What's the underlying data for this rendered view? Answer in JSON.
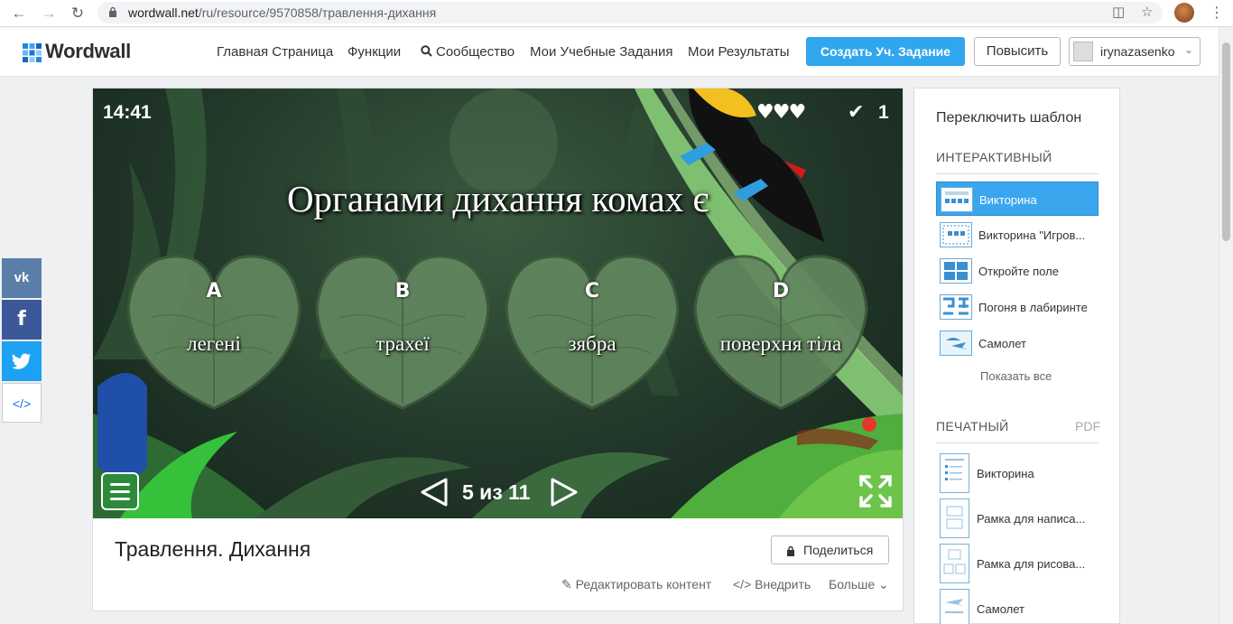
{
  "browser": {
    "url_host": "wordwall.net",
    "url_path": "/ru/resource/9570858/травлення-дихання"
  },
  "header": {
    "logo": "Wordwall",
    "nav": [
      "Главная Страница",
      "Функции",
      "Сообщество",
      "Мои Учебные Задания",
      "Мои Результаты"
    ],
    "create_label": "Создать Уч. Задание",
    "upgrade_label": "Повысить",
    "username": "irynazasenko"
  },
  "social": {
    "vk": "vk",
    "fb": "f",
    "embed": "</>"
  },
  "game": {
    "timer": "14:41",
    "hearts": "♥♥♥",
    "score": "1",
    "question": "Органами дихання комах є",
    "answers": [
      {
        "letter": "A",
        "text": "легені"
      },
      {
        "letter": "B",
        "text": "трахеї"
      },
      {
        "letter": "C",
        "text": "зябра"
      },
      {
        "letter": "D",
        "text": "поверхня тіла"
      }
    ],
    "pager": "5 из 11"
  },
  "activity": {
    "title": "Травлення. Дихання",
    "share_label": "Поделиться",
    "edit_label": "Редактировать контент",
    "embed_label": "Внедрить",
    "more_label": "Больше"
  },
  "switcher": {
    "title": "Переключить шаблон",
    "interactive_heading": "ИНТЕРАКТИВНЫЙ",
    "interactive": [
      {
        "label": "Викторина",
        "icon": "quiz-icon"
      },
      {
        "label": "Викторина \"Игров...",
        "icon": "gameshow-quiz-icon"
      },
      {
        "label": "Откройте поле",
        "icon": "open-box-icon"
      },
      {
        "label": "Погоня в лабиринте",
        "icon": "maze-chase-icon"
      },
      {
        "label": "Самолет",
        "icon": "airplane-icon"
      }
    ],
    "show_all": "Показать все",
    "printable_heading": "ПЕЧАТНЫЙ",
    "pdf_label": "PDF",
    "printable": [
      {
        "label": "Викторина"
      },
      {
        "label": "Рамка для написа..."
      },
      {
        "label": "Рамка для рисова..."
      },
      {
        "label": "Самолет"
      }
    ]
  },
  "colors": {
    "accent": "#30a6ee",
    "vk": "#5a7ea8",
    "facebook": "#3b5998",
    "twitter": "#1da1f2"
  }
}
